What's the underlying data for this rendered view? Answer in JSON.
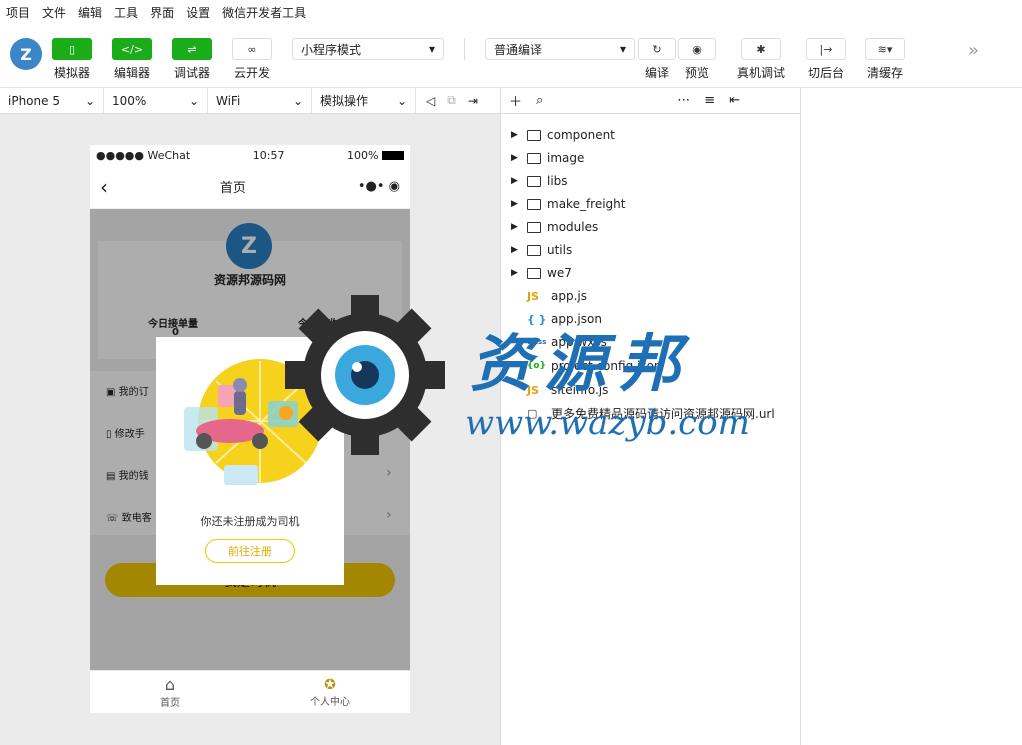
{
  "menubar": [
    "项目",
    "文件",
    "编辑",
    "工具",
    "界面",
    "设置",
    "微信开发者工具"
  ],
  "toolbar": {
    "simulator": "模拟器",
    "editor": "编辑器",
    "debugger": "调试器",
    "cloud": "云开发",
    "mode_select": "小程序模式",
    "compile_select": "普通编译",
    "compile": "编译",
    "preview": "预览",
    "realdebug": "真机调试",
    "background": "切后台",
    "cache": "清缓存",
    "expand": "»"
  },
  "simbar": {
    "device": "iPhone 5",
    "zoom": "100%",
    "network": "WiFi",
    "operation": "模拟操作"
  },
  "phone": {
    "status_left": "●●●●● WeChat",
    "time": "10:57",
    "battery": "100%",
    "nav_title": "首页",
    "brand": "资源邦源码网",
    "stat1_label": "今日接单量",
    "stat1_value": "0",
    "stat2_label": "今日总收入",
    "stat2_value": "0",
    "menu_items": [
      "我的订",
      "修改手",
      "我的钱",
      "致电客"
    ],
    "big_button": "我是司机",
    "modal_text": "你还未注册成为司机",
    "modal_button": "前往注册",
    "tabs": [
      "首页",
      "个人中心"
    ]
  },
  "files": [
    {
      "name": "component",
      "type": "folder"
    },
    {
      "name": "image",
      "type": "folder"
    },
    {
      "name": "libs",
      "type": "folder"
    },
    {
      "name": "make_freight",
      "type": "folder"
    },
    {
      "name": "modules",
      "type": "folder"
    },
    {
      "name": "utils",
      "type": "folder"
    },
    {
      "name": "we7",
      "type": "folder"
    },
    {
      "name": "app.js",
      "type": "js"
    },
    {
      "name": "app.json",
      "type": "json"
    },
    {
      "name": "app.wxss",
      "type": "wxss"
    },
    {
      "name": "project.config.json",
      "type": "config"
    },
    {
      "name": "siteinfo.js",
      "type": "js"
    },
    {
      "name": "更多免费精品源码请访问资源邦源码网.url",
      "type": "file"
    }
  ],
  "watermark": {
    "cn": "资源邦",
    "url": "www.wazyb.com"
  },
  "colors": {
    "green": "#1aad19",
    "gold": "#b8960c",
    "blue": "#2a7fc4"
  }
}
